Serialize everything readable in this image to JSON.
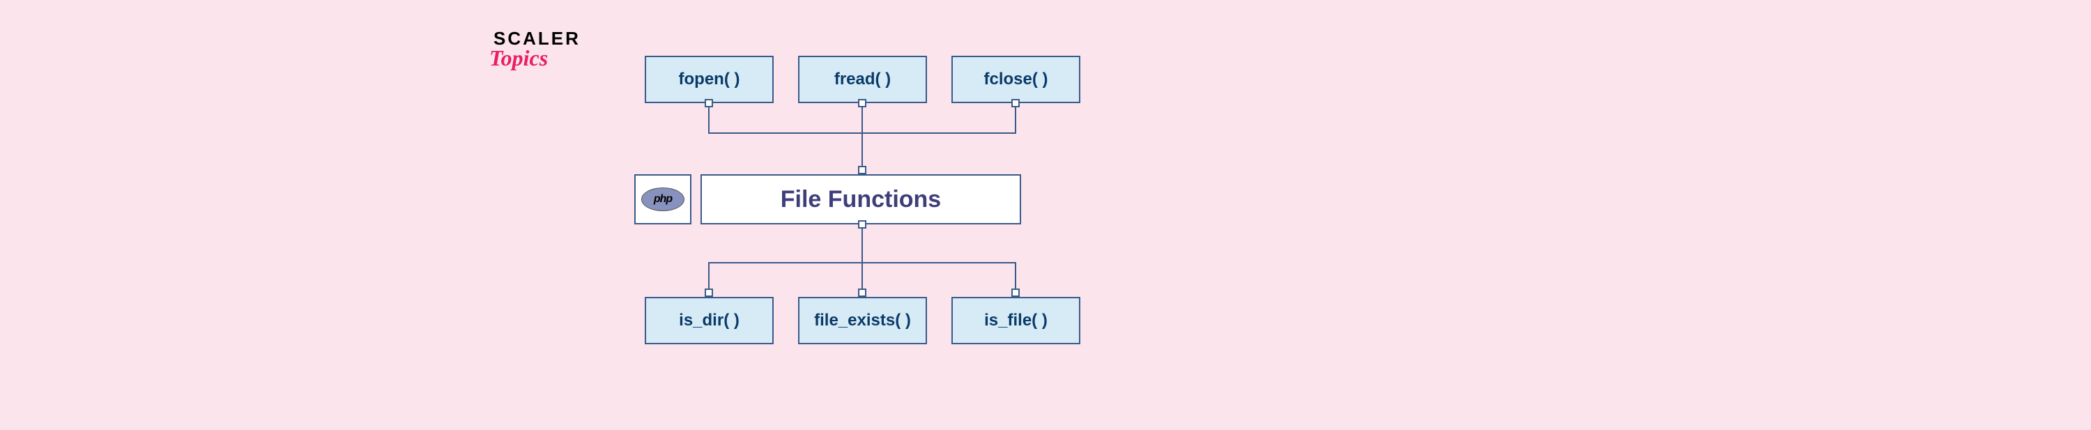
{
  "logo": {
    "line1": "SCALER",
    "line2": "Topics"
  },
  "diagram": {
    "top_functions": [
      {
        "label": "fopen( )"
      },
      {
        "label": "fread( )"
      },
      {
        "label": "fclose( )"
      }
    ],
    "center": {
      "title": "File Functions",
      "icon_label": "php"
    },
    "bottom_functions": [
      {
        "label": "is_dir( )"
      },
      {
        "label": "file_exists( )"
      },
      {
        "label": "is_file( )"
      }
    ]
  }
}
